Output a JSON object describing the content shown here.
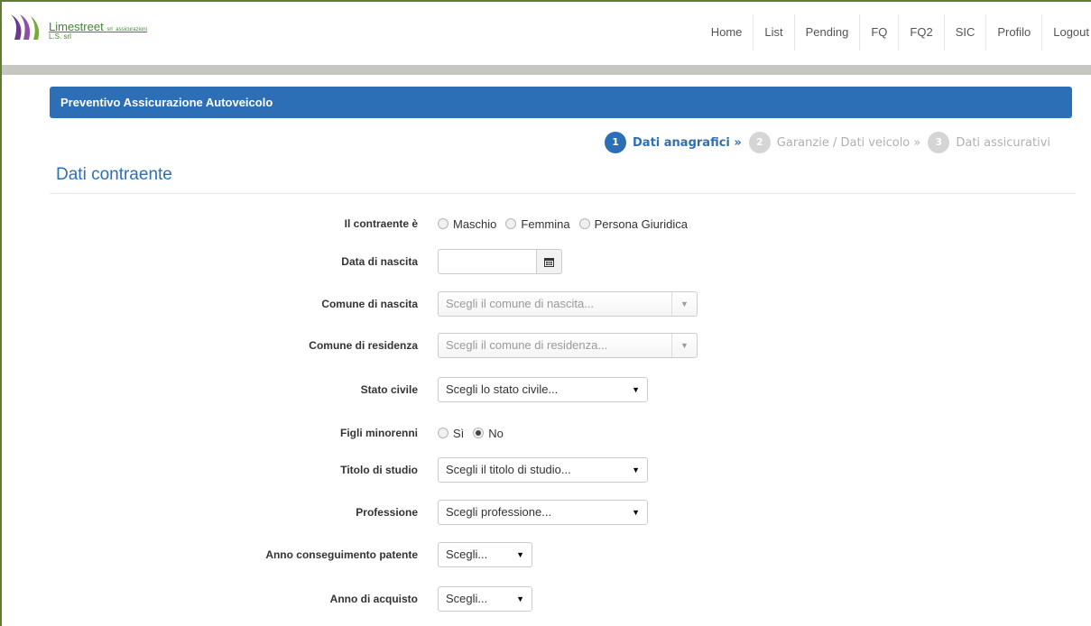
{
  "brand": {
    "name": "Limestreet",
    "name_suffix": "srl",
    "tagline": "assicurazioni",
    "sub": "L.S. srl"
  },
  "nav": {
    "items": [
      "Home",
      "List",
      "Pending",
      "FQ",
      "FQ2",
      "SIC",
      "Profilo",
      "Logout"
    ]
  },
  "panel": {
    "title": "Preventivo Assicurazione Autoveicolo"
  },
  "steps": [
    {
      "num": "1",
      "label": "Dati anagrafici »",
      "state": "active"
    },
    {
      "num": "2",
      "label": "Garanzie / Dati veicolo »",
      "state": "inactive"
    },
    {
      "num": "3",
      "label": "Dati assicurativi",
      "state": "inactive"
    }
  ],
  "section": {
    "title": "Dati contraente"
  },
  "form": {
    "contraente": {
      "label": "Il contraente è",
      "options": [
        "Maschio",
        "Femmina",
        "Persona Giuridica"
      ]
    },
    "data_nascita": {
      "label": "Data di nascita",
      "value": ""
    },
    "comune_nascita": {
      "label": "Comune di nascita",
      "placeholder": "Scegli il comune di nascita..."
    },
    "comune_residenza": {
      "label": "Comune di residenza",
      "placeholder": "Scegli il comune di residenza..."
    },
    "stato_civile": {
      "label": "Stato civile",
      "selected": "Scegli lo stato civile..."
    },
    "figli_minorenni": {
      "label": "Figli minorenni",
      "options": [
        "Sì",
        "No"
      ],
      "checked": "No"
    },
    "titolo_studio": {
      "label": "Titolo di studio",
      "selected": "Scegli il titolo di studio..."
    },
    "professione": {
      "label": "Professione",
      "selected": "Scegli professione..."
    },
    "anno_patente": {
      "label": "Anno conseguimento patente",
      "selected": "Scegli..."
    },
    "anno_acquisto": {
      "label": "Anno di acquisto",
      "selected": "Scegli..."
    }
  },
  "colors": {
    "brand_green": "#3d8a2a",
    "primary_blue": "#2d6fb7",
    "grey_bar": "#c8c6c0"
  }
}
